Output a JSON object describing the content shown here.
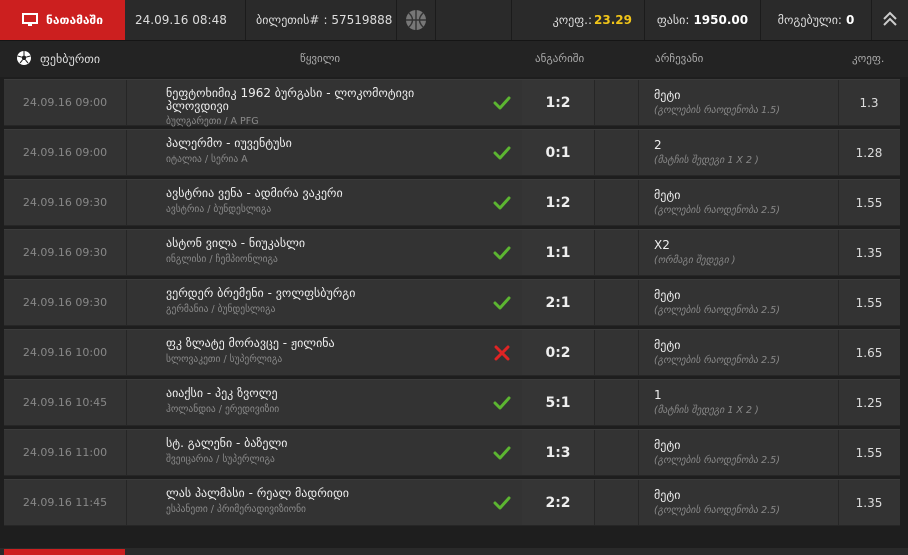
{
  "topbar": {
    "played_label": "ნათამაში",
    "datetime": "24.09.16 08:48",
    "ticket_label": "ბილეთის#",
    "ticket_sep": ":",
    "ticket_number": "57519888",
    "coef_label": "კოეფ.:",
    "coef_value": "23.29",
    "price_label": "ფასი:",
    "price_value": "1950.00",
    "win_label": "მოგებული:",
    "win_value": "0"
  },
  "header": {
    "sport": "ფეხბურთი",
    "event": "წყვილი",
    "score": "ანგარიში",
    "choice": "არჩევანი",
    "coef": "კოეფ."
  },
  "rows": [
    {
      "date": "24.09.16 09:00",
      "title": "ნეფტოხიმიკ 1962 ბურგასი - ლოკომოტივი პლოვდივი",
      "sub": "ბულგარეთი / A PFG",
      "result": "win",
      "score": "1:2",
      "choice": "მეტი",
      "choice_sub": "(გოლების რაოდენობა 1.5)",
      "coef": "1.3"
    },
    {
      "date": "24.09.16 09:00",
      "title": "პალერმო - იუვენტუსი",
      "sub": "იტალია / სერია A",
      "result": "win",
      "score": "0:1",
      "choice": "2",
      "choice_sub": "(მატჩის შედეგი 1 X 2 )",
      "coef": "1.28"
    },
    {
      "date": "24.09.16 09:30",
      "title": "ავსტრია ვენა - ადმირა ვაკერი",
      "sub": "ავსტრია / ბუნდესლიგა",
      "result": "win",
      "score": "1:2",
      "choice": "მეტი",
      "choice_sub": "(გოლების რაოდენობა 2.5)",
      "coef": "1.55"
    },
    {
      "date": "24.09.16 09:30",
      "title": "ასტონ ვილა - ნიუკასლი",
      "sub": "ინგლისი / ჩემპიონლიგა",
      "result": "win",
      "score": "1:1",
      "choice": "X2",
      "choice_sub": "(ორმაგი შედეგი )",
      "coef": "1.35"
    },
    {
      "date": "24.09.16 09:30",
      "title": "ვერდერ ბრემენი - ვოლფსბურგი",
      "sub": "გერმანია / ბუნდესლიგა",
      "result": "win",
      "score": "2:1",
      "choice": "მეტი",
      "choice_sub": "(გოლების რაოდენობა 2.5)",
      "coef": "1.55"
    },
    {
      "date": "24.09.16 10:00",
      "title": "ფკ ზლატე მორავცე - ჟილინა",
      "sub": "სლოვაკეთი / სუპერლიგა",
      "result": "loss",
      "score": "0:2",
      "choice": "მეტი",
      "choice_sub": "(გოლების რაოდენობა 2.5)",
      "coef": "1.65"
    },
    {
      "date": "24.09.16 10:45",
      "title": "აიაქსი - პეკ ზვოლე",
      "sub": "ჰოლანდია / ერედივიზიი",
      "result": "win",
      "score": "5:1",
      "choice": "1",
      "choice_sub": "(მატჩის შედეგი 1 X 2 )",
      "coef": "1.25"
    },
    {
      "date": "24.09.16 11:00",
      "title": "სტ. გალენი - ბაზელი",
      "sub": "შვეიცარია / სუპერლიგა",
      "result": "win",
      "score": "1:3",
      "choice": "მეტი",
      "choice_sub": "(გოლების რაოდენობა 2.5)",
      "coef": "1.55"
    },
    {
      "date": "24.09.16 11:45",
      "title": "ლას პალმასი - რეალ მადრიდი",
      "sub": "ესპანეთი / პრიმერადივიზიონი",
      "result": "win",
      "score": "2:2",
      "choice": "მეტი",
      "choice_sub": "(გოლების რაოდენობა 2.5)",
      "coef": "1.35"
    }
  ],
  "icons": {
    "played": "monitor-icon",
    "ball": "basketball-icon",
    "collapse": "double-chevron-up-icon",
    "sport": "soccer-ball-icon",
    "win": "checkmark-icon",
    "loss": "cross-icon"
  },
  "colors": {
    "accent_red": "#cc1f1f",
    "coef_yellow": "#f0c419",
    "win_green": "#5cb531",
    "loss_red": "#e02424"
  }
}
